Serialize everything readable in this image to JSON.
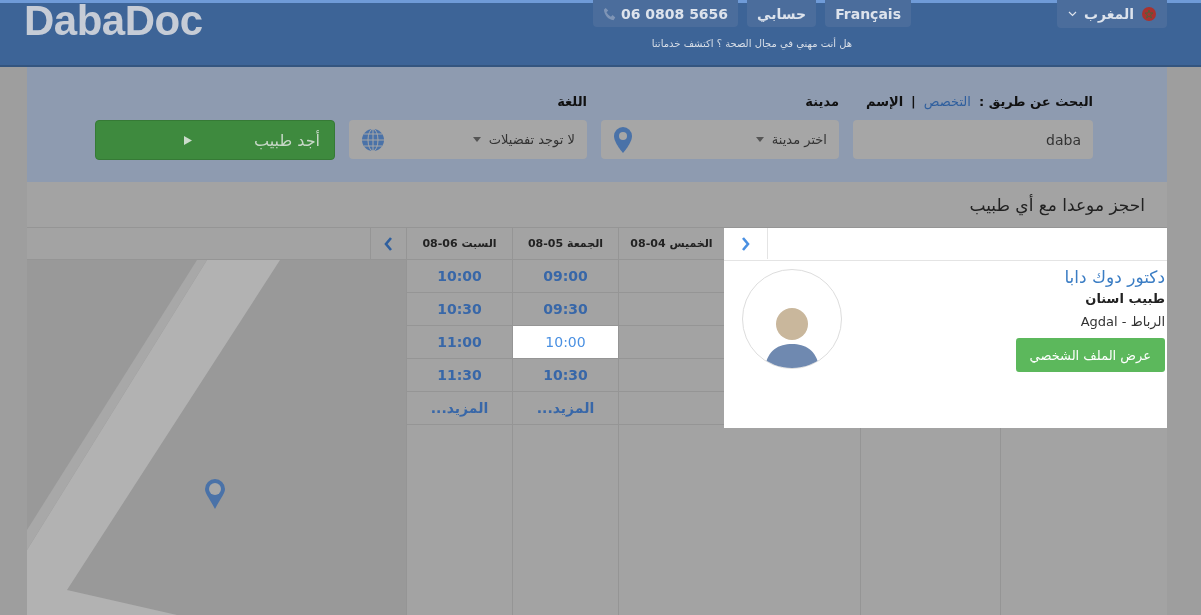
{
  "header": {
    "logo": "DabaDoc",
    "phone": "06 0808 5656",
    "account": "حسابي",
    "language": "Français",
    "pro_prompt": "هل أنت مهني في مجال الصحة ؟ اكتشف خدماتنا",
    "country": "المغرب"
  },
  "search": {
    "by_label": "البحث عن طريق :",
    "by_options": [
      {
        "label": "التخصص",
        "selected": false
      },
      {
        "label": "الإسم",
        "selected": true
      }
    ],
    "separator": "|",
    "city_label": "مدينة",
    "language_label": "اللغة",
    "query": "daba",
    "city_placeholder": "اختر مدينة",
    "language_value": "لا توجد تفضيلات",
    "submit": "أجد طبيب"
  },
  "section_title": "احجز موعدا مع أي طبيب",
  "calendar": {
    "days": [
      {
        "label": "الخميس 04-08"
      },
      {
        "label": "الجمعة 05-08",
        "slots": [
          {
            "time": "09:00",
            "selected": false
          },
          {
            "time": "09:30",
            "selected": false
          },
          {
            "time": "10:00",
            "selected": true
          },
          {
            "time": "10:30",
            "selected": false
          }
        ],
        "more": "المزيد..."
      },
      {
        "label": "السبت 06-08",
        "slots": [
          {
            "time": "10:00",
            "selected": false
          },
          {
            "time": "10:30",
            "selected": false
          },
          {
            "time": "11:00",
            "selected": false
          },
          {
            "time": "11:30",
            "selected": false
          }
        ],
        "more": "المزيد..."
      }
    ]
  },
  "doctor": {
    "name": "دكتور دوك دابا",
    "specialty": "طبيب اسنان",
    "location": "الرباط - Agdal",
    "profile_button": "عرض الملف الشخصي"
  }
}
